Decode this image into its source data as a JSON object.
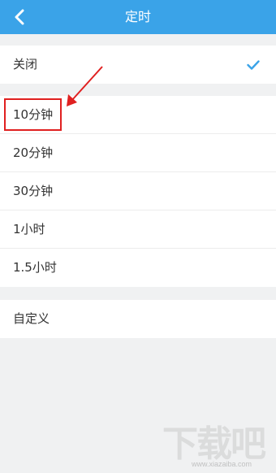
{
  "header": {
    "title": "定时",
    "back_icon": "chevron-left-icon"
  },
  "off_section": {
    "label": "关闭",
    "selected_icon": "check-icon"
  },
  "options": [
    {
      "label": "10分钟"
    },
    {
      "label": "20分钟"
    },
    {
      "label": "30分钟"
    },
    {
      "label": "1小时"
    },
    {
      "label": "1.5小时"
    }
  ],
  "custom": {
    "label": "自定义"
  },
  "watermark": {
    "logo": "下载吧",
    "url": "www.xiazaiba.com"
  },
  "colors": {
    "accent": "#3aa3e8",
    "annotation": "#e02020"
  }
}
